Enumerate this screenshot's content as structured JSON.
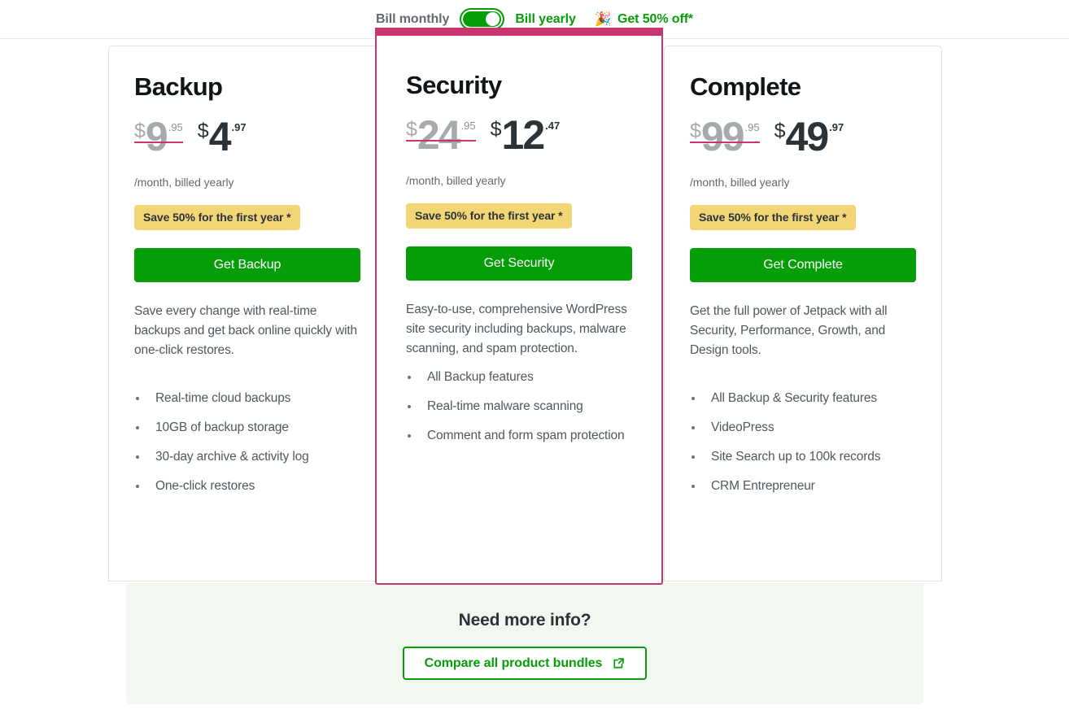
{
  "billing": {
    "monthly_label": "Bill monthly",
    "yearly_label": "Bill yearly",
    "toggle_state": "yearly",
    "promo_emoji": "🎉",
    "promo_text": "Get 50% off*",
    "accent_green": "#069e08",
    "inactive_gray": "#646970"
  },
  "plans": [
    {
      "id": "backup",
      "title": "Backup",
      "featured": false,
      "old_price": {
        "currency": "$",
        "amount": "9",
        "decimals": ".95"
      },
      "new_price": {
        "currency": "$",
        "amount": "4",
        "decimals": ".97"
      },
      "price_note": "/month, billed yearly",
      "save_badge": "Save 50% for the first year *",
      "cta_label": "Get Backup",
      "description": "Save every change with real-time backups and get back online quickly with one-click restores.",
      "features": [
        "Real-time cloud backups",
        "10GB of backup storage",
        "30-day archive & activity log",
        "One-click restores"
      ]
    },
    {
      "id": "security",
      "title": "Security",
      "featured": true,
      "old_price": {
        "currency": "$",
        "amount": "24",
        "decimals": ".95"
      },
      "new_price": {
        "currency": "$",
        "amount": "12",
        "decimals": ".47"
      },
      "price_note": "/month, billed yearly",
      "save_badge": "Save 50% for the first year *",
      "cta_label": "Get Security",
      "description": "Easy-to-use, comprehensive WordPress site security including backups, malware scanning, and spam protection.",
      "features": [
        "All Backup features",
        "Real-time malware scanning",
        "Comment and form spam protection"
      ]
    },
    {
      "id": "complete",
      "title": "Complete",
      "featured": false,
      "old_price": {
        "currency": "$",
        "amount": "99",
        "decimals": ".95"
      },
      "new_price": {
        "currency": "$",
        "amount": "49",
        "decimals": ".97"
      },
      "price_note": "/month, billed yearly",
      "save_badge": "Save 50% for the first year *",
      "cta_label": "Get Complete",
      "description": "Get the full power of Jetpack with all Security, Performance, Growth, and Design tools.",
      "features": [
        "All Backup & Security features",
        "VideoPress",
        "Site Search up to 100k records",
        "CRM Entrepreneur"
      ]
    }
  ],
  "info_panel": {
    "title": "Need more info?",
    "compare_label": "Compare all product bundles",
    "compare_icon": "external-link-icon",
    "background": "#f2f7ef"
  },
  "colors": {
    "featured_border": "#c9356e",
    "badge_yellow": "#f2d675",
    "cta_green": "#069e08"
  }
}
